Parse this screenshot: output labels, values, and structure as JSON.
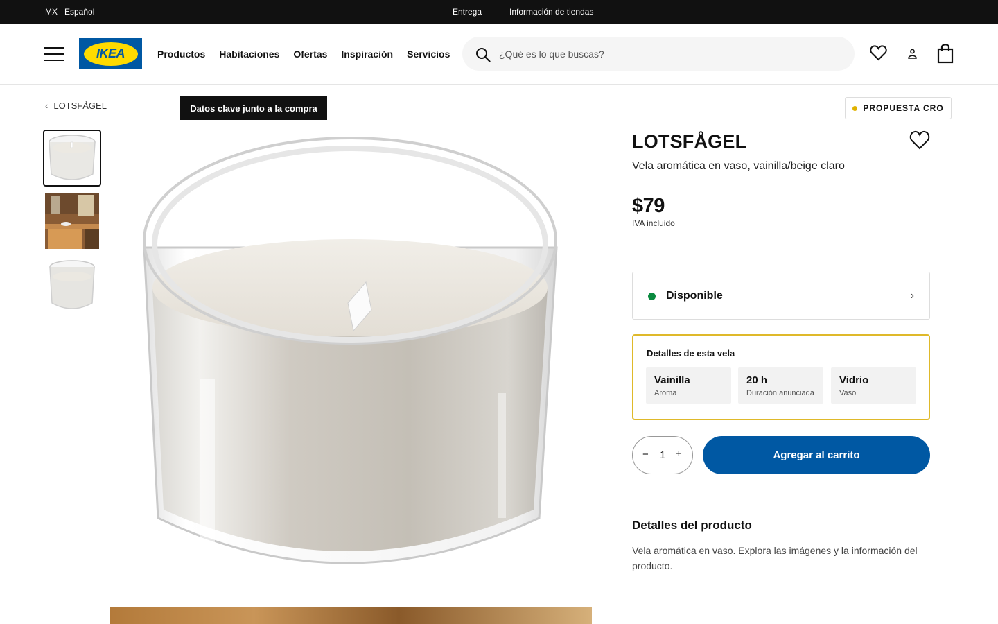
{
  "topbar": {
    "country": "MX",
    "language": "Español",
    "delivery": "Entrega",
    "stores": "Información de tiendas"
  },
  "header": {
    "logo_text": "IKEA",
    "nav": [
      "Productos",
      "Habitaciones",
      "Ofertas",
      "Inspiración",
      "Servicios"
    ],
    "search_placeholder": "¿Qué es lo que buscas?"
  },
  "breadcrumb": {
    "label": "LOTSFÅGEL"
  },
  "badges": {
    "key_data": "Datos clave junto a la compra",
    "cro": "PROPUESTA CRO"
  },
  "product": {
    "name": "LOTSFÅGEL",
    "description": "Vela aromática en vaso, vainilla/beige claro",
    "price": "$79",
    "tax_note": "IVA incluido",
    "availability": "Disponible",
    "details_box": {
      "title": "Detalles de esta vela",
      "cards": [
        {
          "value": "Vainilla",
          "label": "Aroma"
        },
        {
          "value": "20 h",
          "label": "Duración anunciada"
        },
        {
          "value": "Vidrio",
          "label": "Vaso"
        }
      ]
    },
    "quantity": "1",
    "add_to_cart": "Agregar al carrito",
    "details_title": "Detalles del producto",
    "details_text": "Vela aromática en vaso. Explora las imágenes y la información del producto."
  },
  "colors": {
    "brand_blue": "#0058a3",
    "brand_yellow": "#ffdb00",
    "available_green": "#0a8a3f",
    "highlight_border": "#dfb92a"
  },
  "icons": {
    "menu": "hamburger-icon",
    "search": "search-icon",
    "favorites": "heart-icon",
    "account": "person-icon",
    "cart": "shopping-bag-icon",
    "back": "chevron-left-icon",
    "availability_arrow": "chevron-right-icon"
  }
}
